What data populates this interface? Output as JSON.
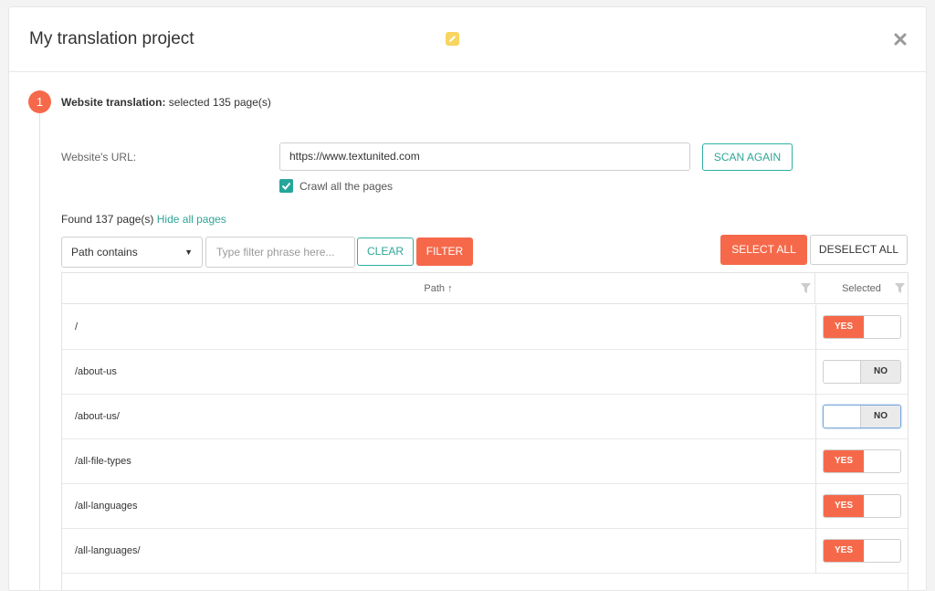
{
  "modal": {
    "title": "My translation project",
    "edit_icon": "edit-icon",
    "close_icon": "close-icon"
  },
  "step": {
    "number": "1",
    "title_bold": "Website translation:",
    "title_rest": " selected 135 page(s)"
  },
  "url": {
    "label": "Website's URL:",
    "value": "https://www.textunited.com",
    "scan_button": "SCAN AGAIN",
    "crawl_label": "Crawl all the pages",
    "crawl_checked": true
  },
  "found": {
    "text": "Found 137 page(s) ",
    "link": "Hide all pages"
  },
  "filter": {
    "select_value": "Path contains",
    "input_placeholder": "Type filter phrase here...",
    "clear_button": "CLEAR",
    "filter_button": "FILTER",
    "select_all_button": "SELECT ALL",
    "deselect_all_button": "DESELECT ALL"
  },
  "grid": {
    "columns": [
      "Path ↑",
      "Selected"
    ],
    "rows": [
      {
        "path": "/",
        "selected": "YES"
      },
      {
        "path": "/about-us",
        "selected": "NO"
      },
      {
        "path": "/about-us/",
        "selected": "NO"
      },
      {
        "path": "/all-file-types",
        "selected": "YES"
      },
      {
        "path": "/all-languages",
        "selected": "YES"
      },
      {
        "path": "/all-languages/",
        "selected": "YES"
      }
    ]
  },
  "colors": {
    "accent": "#f5694a",
    "teal": "#2fa597"
  }
}
